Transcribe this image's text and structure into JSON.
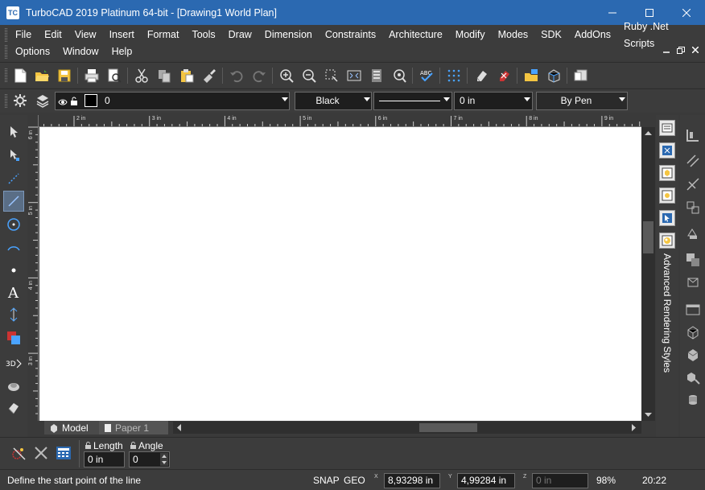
{
  "window": {
    "app_icon": "TC",
    "title": "TurboCAD 2019 Platinum 64-bit - [Drawing1 World Plan]"
  },
  "menu": {
    "row1": [
      "File",
      "Edit",
      "View",
      "Insert",
      "Format",
      "Tools",
      "Draw",
      "Dimension",
      "Constraints",
      "Architecture",
      "Modify",
      "Modes",
      "SDK",
      "AddOns",
      "Ruby .Net Scripts"
    ],
    "row2": [
      "Options",
      "Window",
      "Help"
    ]
  },
  "toolbar_icons": [
    "new-file-icon",
    "open-folder-icon",
    "save-icon",
    "print-icon",
    "print-preview-icon",
    "cut-icon",
    "copy-icon",
    "paste-icon",
    "format-painter-icon",
    "undo-icon",
    "redo-icon",
    "zoom-in-icon",
    "zoom-out-icon",
    "zoom-window-icon",
    "zoom-extents-icon",
    "zoom-page-icon",
    "zoom-dynamic-icon",
    "spell-check-icon",
    "snap-grid-icon",
    "eraser-icon",
    "delete-entity-icon",
    "open-design-director-icon",
    "3d-view-icon",
    "properties-icon"
  ],
  "property_bar": {
    "layer_value": "0",
    "pen_color": "Black",
    "line_width": "0 in",
    "line_style": "By Pen"
  },
  "rulers": {
    "h_labels": [
      "2 in",
      "3 in",
      "4 in",
      "5 in",
      "6 in",
      "7 in",
      "8 in",
      "9 in"
    ],
    "v_labels": [
      "6 in",
      "5 in",
      "4 in",
      "3 in"
    ]
  },
  "left_tools": [
    "select-icon",
    "node-edit-icon",
    "point-icon",
    "line-icon",
    "circle-icon",
    "arc-icon",
    "dot-icon",
    "text-icon",
    "dimension-icon",
    "hatch-icon",
    "3d-icon",
    "render-icon",
    "eraser-icon"
  ],
  "right_palette": {
    "vertical_label": "Advanced Rendering Styles"
  },
  "tabs": {
    "model": "Model",
    "paper": "Paper 1"
  },
  "input_bar": {
    "length_label": "Length",
    "angle_label": "Angle",
    "length_value": "0 in",
    "angle_value": "0"
  },
  "status": {
    "prompt": "Define the start point of the line",
    "snap": "SNAP",
    "geo": "GEO",
    "x_value": "8,93298 in",
    "y_value": "4,99284 in",
    "z_value": "0 in",
    "zoom": "98%",
    "time": "20:22",
    "x_axis": "X",
    "y_axis": "Y",
    "z_axis": "Z"
  }
}
